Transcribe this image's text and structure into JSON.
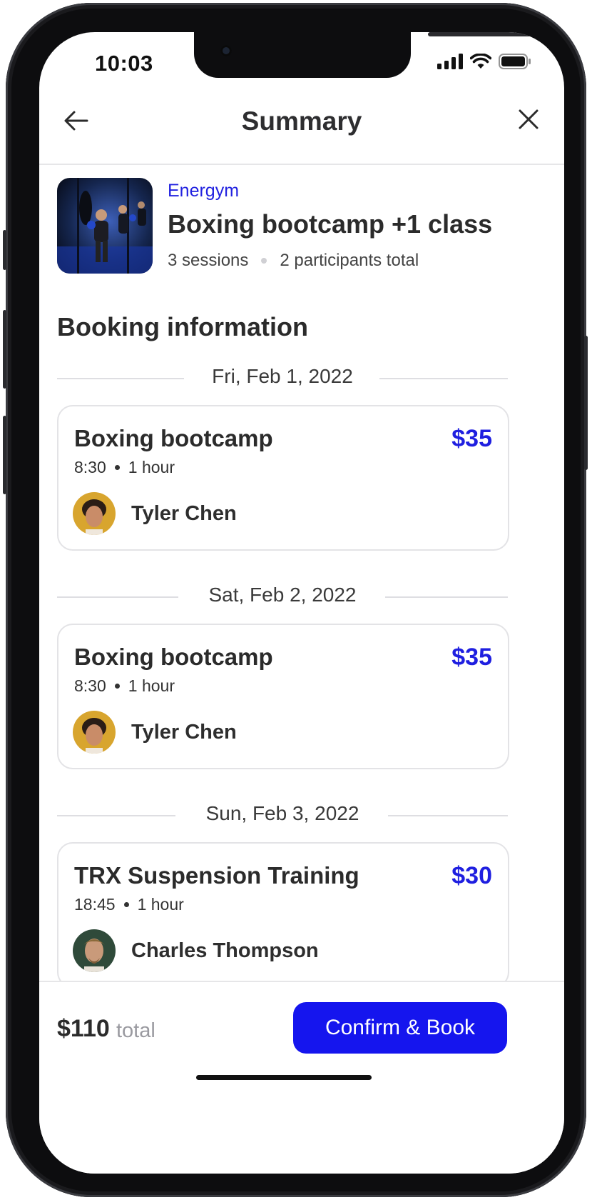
{
  "status_bar": {
    "time": "10:03"
  },
  "nav": {
    "title": "Summary"
  },
  "header": {
    "brand": "Energym",
    "title": "Boxing bootcamp +1 class",
    "sessions": "3 sessions",
    "participants": "2 participants total"
  },
  "section_title": "Booking information",
  "bookings": [
    {
      "date": "Fri, Feb 1, 2022",
      "class": "Boxing bootcamp",
      "price": "$35",
      "time": "8:30",
      "duration": "1 hour",
      "instructor": "Tyler Chen"
    },
    {
      "date": "Sat, Feb 2, 2022",
      "class": "Boxing bootcamp",
      "price": "$35",
      "time": "8:30",
      "duration": "1 hour",
      "instructor": "Tyler Chen"
    },
    {
      "date": "Sun, Feb 3, 2022",
      "class": "TRX Suspension Training",
      "price": "$30",
      "time": "18:45",
      "duration": "1 hour",
      "instructor": "Charles Thompson"
    }
  ],
  "footer": {
    "total_amount": "$110",
    "total_label": "total",
    "cta_label": "Confirm & Book"
  },
  "colors": {
    "accent": "#1515ee",
    "brand_text": "#2222e0",
    "price": "#1f1fe0"
  }
}
